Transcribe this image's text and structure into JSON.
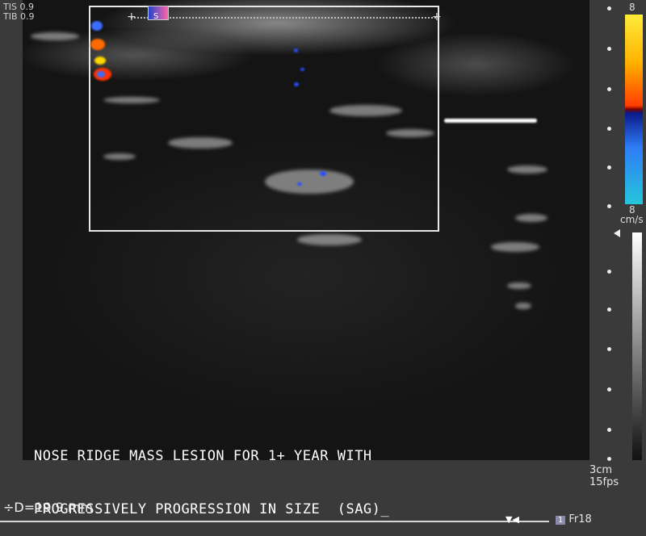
{
  "header": {
    "tis": "TIS 0.9",
    "tib": "TIB 0.9"
  },
  "color_scale": {
    "top_value": "8",
    "bottom_value": "8",
    "unit": "cm/s",
    "colors": [
      "#ffeb3b",
      "#ff3d00",
      "#0b1a8a",
      "#26c6da"
    ]
  },
  "caption": {
    "line1": "NOSE RIDGE MASS LESION FOR 1+ YEAR WITH",
    "line2": "PROGRESSIVELY PROGRESSION IN SIZE  (SAG)_"
  },
  "depth": "3cm",
  "frame_rate": "15fps",
  "measurement": "÷D=19.9 mm",
  "frame": {
    "badge": "1",
    "label": "Fr18"
  }
}
